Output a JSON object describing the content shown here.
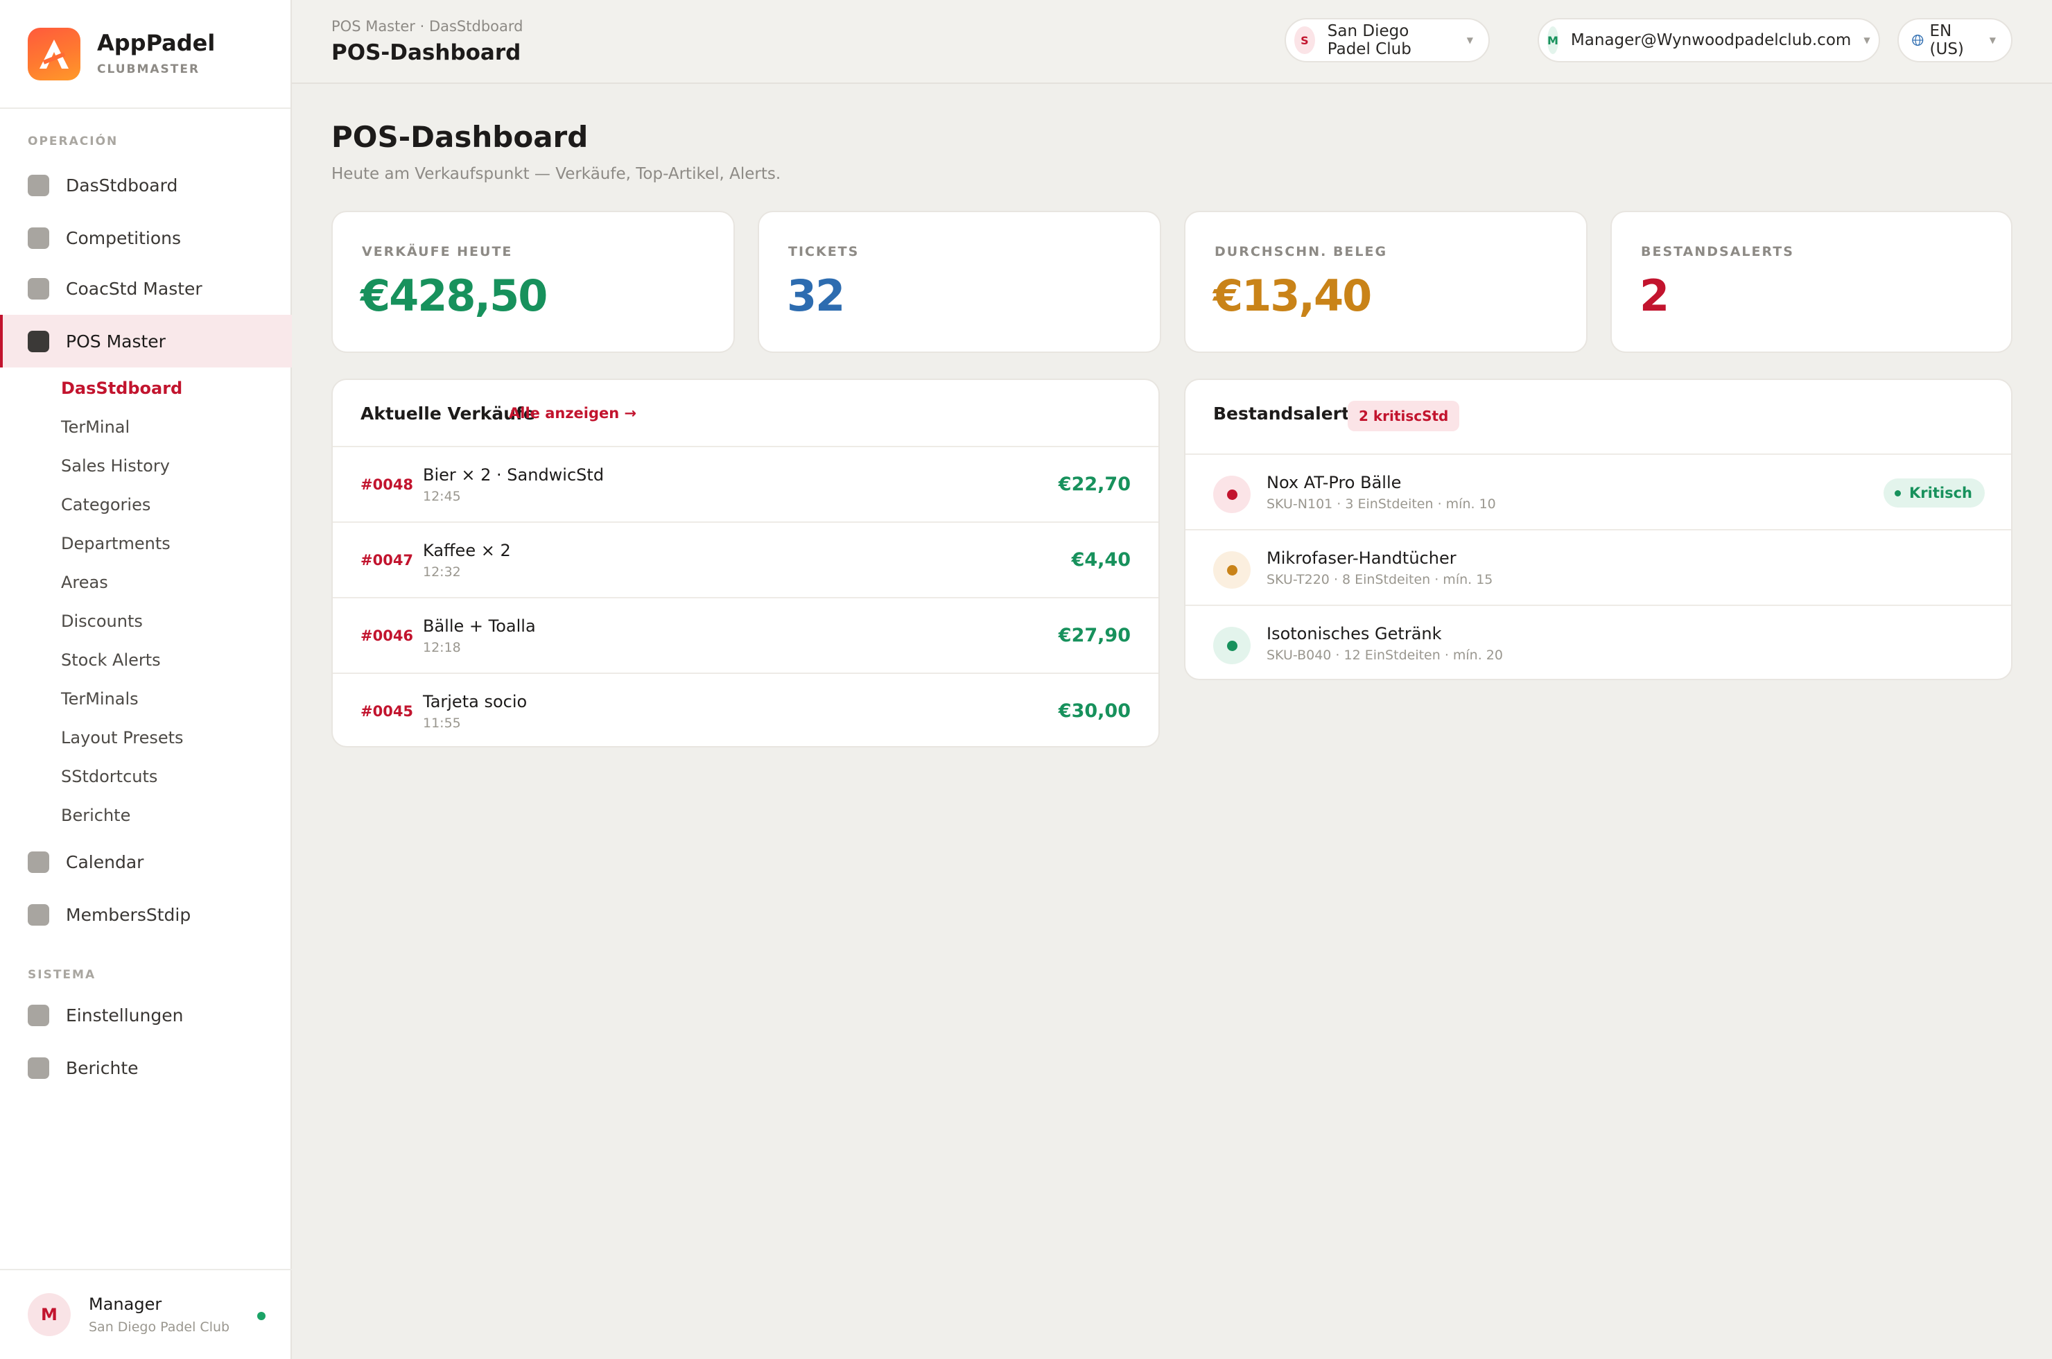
{
  "brand": {
    "name": "AppPadel",
    "sub": "CLUBMASTER"
  },
  "sidebar": {
    "section_operacion": "OPERACIÓN",
    "section_sistema": "SISTEMA",
    "items": [
      {
        "label": "DasStdboard"
      },
      {
        "label": "Competitions"
      },
      {
        "label": "CoacStd Master"
      },
      {
        "label": "POS Master"
      },
      {
        "label": "Calendar"
      },
      {
        "label": "MembersStdip"
      },
      {
        "label": "Einstellungen"
      },
      {
        "label": "Berichte"
      }
    ],
    "sub_items": [
      {
        "label": "DasStdboard"
      },
      {
        "label": "TerMinal"
      },
      {
        "label": "Sales History"
      },
      {
        "label": "Categories"
      },
      {
        "label": "Departments"
      },
      {
        "label": "Areas"
      },
      {
        "label": "Discounts"
      },
      {
        "label": "Stock Alerts"
      },
      {
        "label": "TerMinals"
      },
      {
        "label": "Layout Presets"
      },
      {
        "label": "SStdortcuts"
      },
      {
        "label": "Berichte"
      }
    ],
    "user": {
      "initial": "M",
      "name": "Manager",
      "club": "San Diego Padel Club"
    }
  },
  "topbar": {
    "breadcrumb": "POS Master · DasStdboard",
    "title": "POS-Dashboard",
    "club": {
      "initial": "S",
      "label": "San Diego Padel Club"
    },
    "account": {
      "initial": "M",
      "label": "Manager@Wynwoodpadelclub.com"
    },
    "language": "EN (US)"
  },
  "main": {
    "title": "POS-Dashboard",
    "subtitle": "Heute am Verkaufspunkt — Verkäufe, Top-Artikel, Alerts.",
    "stats": [
      {
        "label": "VERKÄUFE HEUTE",
        "value": "€428,50",
        "color": "#17915c"
      },
      {
        "label": "TICKETS",
        "value": "32",
        "color": "#2d6cb0"
      },
      {
        "label": "DURCHSCHN. BELEG",
        "value": "€13,40",
        "color": "#c98318"
      },
      {
        "label": "BESTANDSALERTS",
        "value": "2",
        "color": "#c2142e"
      }
    ],
    "sales": {
      "title": "Aktuelle Verkäufe",
      "link": "Alle anzeigen →",
      "rows": [
        {
          "no": "#0048",
          "desc": "Bier × 2 · SandwicStd",
          "time": "12:45",
          "amount": "€22,70"
        },
        {
          "no": "#0047",
          "desc": "Kaffee × 2",
          "time": "12:32",
          "amount": "€4,40"
        },
        {
          "no": "#0046",
          "desc": "Bälle + Toalla",
          "time": "12:18",
          "amount": "€27,90"
        },
        {
          "no": "#0045",
          "desc": "Tarjeta socio",
          "time": "11:55",
          "amount": "€30,00"
        }
      ]
    },
    "alerts": {
      "title": "Bestandsalerts",
      "badge": "2 kritiscStd",
      "rows": [
        {
          "name": "Nox AT-Pro Bälle",
          "meta": "SKU-N101 · 3 EinStdeiten · mín. 10",
          "status": "Kritisch",
          "color": "#c2142e",
          "bg": "#fbe4e7"
        },
        {
          "name": "Mikrofaser-Handtücher",
          "meta": "SKU-T220 · 8 EinStdeiten · mín. 15",
          "color": "#c98318",
          "bg": "#fbefdf"
        },
        {
          "name": "Isotonisches Getränk",
          "meta": "SKU-B040 · 12 EinStdeiten · mín. 20",
          "color": "#17915c",
          "bg": "#e3f4ec"
        }
      ]
    }
  }
}
